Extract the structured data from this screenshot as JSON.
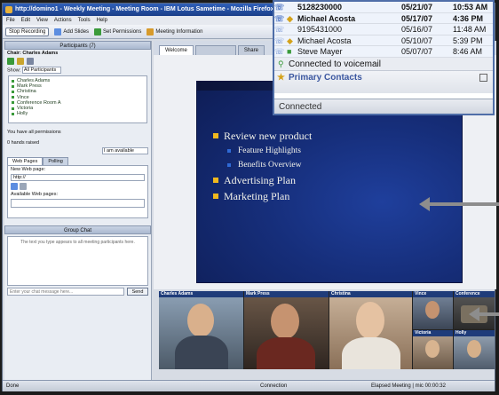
{
  "window": {
    "title": "http://domino1 - Weekly Meeting - Meeting Room - IBM Lotus Sametime - Mozilla Firefox",
    "menu": [
      "File",
      "Edit",
      "View",
      "Actions",
      "Tools",
      "Help"
    ]
  },
  "toolbar": {
    "stop_recording": "Stop Recording",
    "add_slides": "Add Slides",
    "set_permissions": "Set Permissions",
    "meeting_info": "Meeting Information"
  },
  "participants": {
    "header": "Participants (7)",
    "chair": "Chair: Charles Adams",
    "show_label": "Show:",
    "show_value": "All Participants",
    "names": [
      "Charles Adams",
      "Mark Press",
      "Christina",
      "Vince",
      "Conference Room A",
      "Victoria",
      "Holly"
    ],
    "permissions_note": "You have all permissions",
    "hands_raised": "0 hands raised",
    "status_value": "I am available"
  },
  "web_tabs": {
    "tab_web_pages": "Web Pages",
    "tab_polling": "Polling",
    "new_page_label": "New Web page:",
    "new_page_value": "http://",
    "available_label": "Available Web pages:"
  },
  "chat": {
    "header": "Group Chat",
    "note": "The text you type appears to all meeting participants here.",
    "input_placeholder": "Enter your chat message here...",
    "send_label": "Send"
  },
  "presentation": {
    "tabs": [
      "Welcome",
      "",
      "Share"
    ],
    "bullets": [
      {
        "text": "Review new product",
        "level": 1
      },
      {
        "text": "Feature Highlights",
        "level": 2
      },
      {
        "text": "Benefits Overview",
        "level": 2
      },
      {
        "text": "Advertising Plan",
        "level": 1
      },
      {
        "text": "Marketing Plan",
        "level": 1
      }
    ]
  },
  "video": {
    "participants": [
      "Charles Adams",
      "Mark Press",
      "Christina",
      "Vince",
      "Conference",
      "Victoria",
      "Holly"
    ]
  },
  "status": {
    "left": "Done",
    "connection": "Connection",
    "recording": "Elapsed Meeting | mic 00:00:32"
  },
  "contacts_popup": {
    "calls": [
      {
        "name": "5128230000",
        "date": "05/21/07",
        "time": "10:53 AM",
        "bold": true
      },
      {
        "name": "Michael Acosta",
        "date": "05/17/07",
        "time": "4:36 PM",
        "bold": true
      },
      {
        "name": "9195431000",
        "date": "05/16/07",
        "time": "11:48 AM",
        "bold": false
      },
      {
        "name": "Michael Acosta",
        "date": "05/10/07",
        "time": "5:39 PM",
        "bold": false
      },
      {
        "name": "Steve Mayer",
        "date": "05/07/07",
        "time": "8:46 AM",
        "bold": false
      }
    ],
    "voicemail": "Connected to voicemail",
    "primary_contacts": "Primary Contacts",
    "connected": "Connected"
  },
  "colors": {
    "slide_bg": "#162e7a",
    "bullet_gold": "#f0b81e",
    "title_bar": "#2f5fb8"
  }
}
